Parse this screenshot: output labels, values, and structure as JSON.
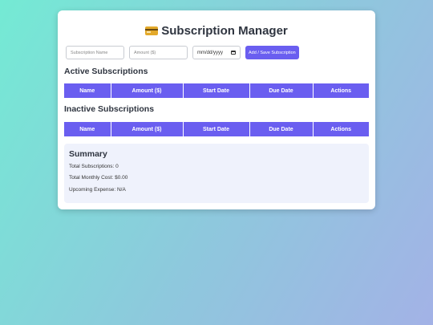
{
  "header": {
    "title": "Subscription Manager",
    "icon": "credit-card-icon"
  },
  "form": {
    "name_placeholder": "Subscription Name",
    "amount_placeholder": "Amount ($)",
    "date_value": "mm/dd/yyyy",
    "submit_label": "Add / Save Subscription"
  },
  "active": {
    "heading": "Active Subscriptions",
    "columns": [
      "Name",
      "Amount ($)",
      "Start Date",
      "Due Date",
      "Actions"
    ]
  },
  "inactive": {
    "heading": "Inactive Subscriptions",
    "columns": [
      "Name",
      "Amount ($)",
      "Start Date",
      "Due Date",
      "Actions"
    ]
  },
  "summary": {
    "heading": "Summary",
    "total_subscriptions": "Total Subscriptions: 0",
    "total_monthly_cost": "Total Monthly Cost: $0.00",
    "upcoming_expense": "Upcoming Expense: N/A"
  },
  "colors": {
    "accent": "#6a5ef0",
    "summary_bg": "#eff2fc"
  }
}
